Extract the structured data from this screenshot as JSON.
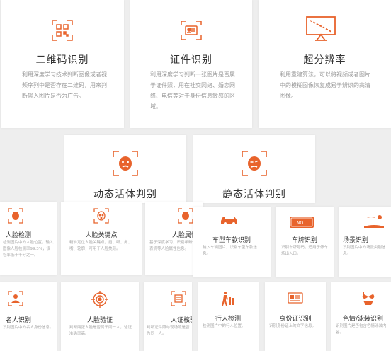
{
  "theme": {
    "accent": "#e8632c",
    "background": "#eeeeee",
    "card": "#ffffff"
  },
  "row1": [
    {
      "title": "二维码识别",
      "icon": "qr-code-icon",
      "desc": "利用深度学习技术判断图像或者视频序列中是否存在二维码，用来判断输入图片是否为广告。"
    },
    {
      "title": "证件识别",
      "icon": "id-card-icon",
      "desc": "利用深度学习判断一张图片是否属于证件照，用在社交网络、婚恋网络、电信等对于身份信息敏感的区域。"
    },
    {
      "title": "超分辨率",
      "icon": "monitor-icon",
      "desc": "利用重建算法，可以将视频或者图片中的模糊图像恢复成易于辨识的高清图像。"
    }
  ],
  "row2": [
    {
      "title": "动态活体判别",
      "icon": "dynamic-face-icon"
    },
    {
      "title": "静态活体判别",
      "icon": "static-face-icon"
    }
  ],
  "row3_left": [
    {
      "title": "人脸检测",
      "icon": "face-detect-icon",
      "desc": "检测图片中的人脸位置，输入图像人脸检测率99.3%，误检率低于千分之一。"
    },
    {
      "title": "人脸关键点",
      "icon": "face-landmark-icon",
      "desc": "精准定位人脸关键点，眉、眼、鼻、嘴、轮廓，可用于人脸美颜。"
    },
    {
      "title": "人脸属性",
      "icon": "face-attribute-icon",
      "desc": "基于深度学习，识别年龄性别表情等人脸属性信息。"
    }
  ],
  "row3_right": [
    {
      "title": "车型车款识别",
      "icon": "car-icon",
      "desc": "输入车辆图片，识别车型车款信息。"
    },
    {
      "title": "车牌识别",
      "icon": "license-plate-icon",
      "plate_text": "NO.",
      "desc": "识别车牌号码，适用于停车场出入口。"
    },
    {
      "title": "场景识别",
      "icon": "beach-scene-icon",
      "desc": "识别图片中的场景类别信息。"
    }
  ],
  "row4_left": [
    {
      "title": "名人识别",
      "icon": "celebrity-icon",
      "desc": "识别图片中的名人身份信息。"
    },
    {
      "title": "人脸验证",
      "icon": "target-icon",
      "desc": "判断两张人脸是否属于同一人，验证准确率高。"
    },
    {
      "title": "人证核验",
      "icon": "id-verify-icon",
      "desc": "判断证件照与现场照是否为同一人。"
    }
  ],
  "row4_right": [
    {
      "title": "行人检测",
      "icon": "pedestrian-icon",
      "desc": "检测图片中的行人位置。"
    },
    {
      "title": "身份证识别",
      "icon": "id-ocr-icon",
      "desc": "识别身份证上的文字信息。"
    },
    {
      "title": "色情/泳装识别",
      "icon": "bikini-icon",
      "desc": "识别图片是否包含色情泳装内容。"
    }
  ]
}
